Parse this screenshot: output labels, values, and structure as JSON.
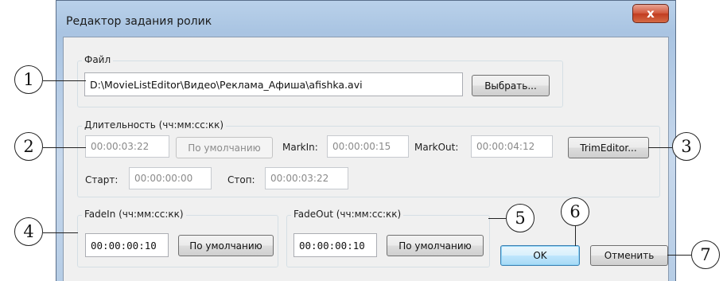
{
  "window": {
    "title": "Редактор задания ролик",
    "close_glyph": "x"
  },
  "file_group": {
    "label": "Файл",
    "path": "D:\\MovieListEditor\\Видео\\Реклама_Афиша\\afishka.avi",
    "browse_label": "Выбрать..."
  },
  "duration_group": {
    "label": "Длительность (чч:мм:сс:кк)",
    "duration": "00:00:03:22",
    "default_label": "По умолчанию",
    "markin_label": "MarkIn:",
    "markin": "00:00:00:15",
    "markout_label": "MarkOut:",
    "markout": "00:00:04:12",
    "trim_label": "TrimEditor...",
    "start_label": "Старт:",
    "start": "00:00:00:00",
    "stop_label": "Стоп:",
    "stop": "00:00:03:22"
  },
  "fadein_group": {
    "label": "FadeIn (чч:мм:сс:кк)",
    "value": "00:00:00:10",
    "default_label": "По умолчанию"
  },
  "fadeout_group": {
    "label": "FadeOut (чч:мм:сс:кк)",
    "value": "00:00:00:10",
    "default_label": "По умолчанию"
  },
  "buttons": {
    "ok": "OK",
    "cancel": "Отменить"
  },
  "callouts": [
    "1",
    "2",
    "3",
    "4",
    "5",
    "6",
    "7"
  ]
}
